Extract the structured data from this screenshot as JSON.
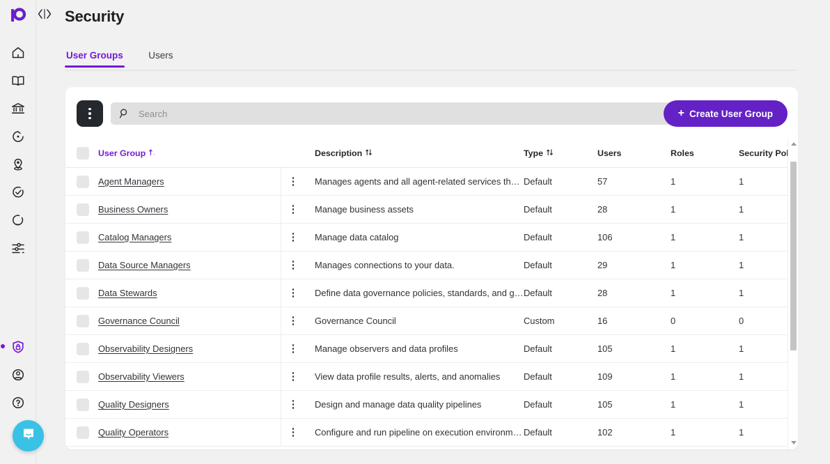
{
  "brand": {
    "logo_name": "prophecy-logo",
    "accent": "#7518d8",
    "button_purple": "#6321c6",
    "chat_color": "#39c1e6"
  },
  "rail": {
    "code_icon": "code-brackets-icon",
    "items": [
      {
        "icon": "home-icon",
        "name": "home"
      },
      {
        "icon": "book-icon",
        "name": "docs"
      },
      {
        "icon": "bank-icon",
        "name": "warehouse"
      },
      {
        "icon": "clock-arrow-icon",
        "name": "jobs"
      },
      {
        "icon": "location-pin-icon",
        "name": "locations"
      },
      {
        "icon": "check-circle-icon",
        "name": "quality"
      },
      {
        "icon": "refresh-circle-icon",
        "name": "observability"
      },
      {
        "icon": "sliders-icon",
        "name": "settings"
      }
    ],
    "bottom_items": [
      {
        "icon": "shield-lock-icon",
        "name": "security",
        "active": true
      },
      {
        "icon": "user-circle-icon",
        "name": "account",
        "active": false
      },
      {
        "icon": "help-circle-icon",
        "name": "help",
        "active": false
      }
    ],
    "chat_icon": "chat-bubble-icon"
  },
  "header": {
    "title": "Security"
  },
  "tabs": [
    {
      "label": "User Groups",
      "active": true
    },
    {
      "label": "Users",
      "active": false
    }
  ],
  "toolbar": {
    "kebab_icon": "more-vertical-icon",
    "search_icon": "search-icon",
    "search_placeholder": "Search",
    "search_value": "",
    "create_label": "Create User Group",
    "create_plus": "+"
  },
  "table": {
    "columns": [
      {
        "key": "name",
        "label": "User Group",
        "sortable": true,
        "sorted": "asc",
        "active": true
      },
      {
        "key": "description",
        "label": "Description",
        "sortable": true,
        "sorted": "none",
        "active": false
      },
      {
        "key": "type",
        "label": "Type",
        "sortable": true,
        "sorted": "none",
        "active": false
      },
      {
        "key": "users",
        "label": "Users",
        "sortable": false,
        "active": false
      },
      {
        "key": "roles",
        "label": "Roles",
        "sortable": false,
        "active": false
      },
      {
        "key": "policies",
        "label": "Security Policies",
        "sortable": false,
        "active": false
      }
    ],
    "rows": [
      {
        "name": "Agent Managers",
        "description": "Manages agents and all agent-related services that ...",
        "type": "Default",
        "users": "57",
        "roles": "1",
        "policies": "1"
      },
      {
        "name": "Business Owners",
        "description": "Manage business assets",
        "type": "Default",
        "users": "28",
        "roles": "1",
        "policies": "1"
      },
      {
        "name": "Catalog Managers",
        "description": "Manage data catalog",
        "type": "Default",
        "users": "106",
        "roles": "1",
        "policies": "1"
      },
      {
        "name": "Data Source Managers",
        "description": "Manages connections to your data.",
        "type": "Default",
        "users": "29",
        "roles": "1",
        "policies": "1"
      },
      {
        "name": "Data Stewards",
        "description": "Define data governance policies, standards, and gui...",
        "type": "Default",
        "users": "28",
        "roles": "1",
        "policies": "1"
      },
      {
        "name": "Governance Council",
        "description": "Governance Council",
        "type": "Custom",
        "users": "16",
        "roles": "0",
        "policies": "0"
      },
      {
        "name": "Observability Designers",
        "description": "Manage observers and data profiles",
        "type": "Default",
        "users": "105",
        "roles": "1",
        "policies": "1"
      },
      {
        "name": "Observability Viewers",
        "description": "View data profile results, alerts, and anomalies",
        "type": "Default",
        "users": "109",
        "roles": "1",
        "policies": "1"
      },
      {
        "name": "Quality Designers",
        "description": "Design and manage data quality pipelines",
        "type": "Default",
        "users": "105",
        "roles": "1",
        "policies": "1"
      },
      {
        "name": "Quality Operators",
        "description": "Configure and run pipeline on execution environment",
        "type": "Default",
        "users": "102",
        "roles": "1",
        "policies": "1"
      }
    ],
    "row_kebab_icon": "more-vertical-icon",
    "row_checkbox_name": "row-checkbox",
    "select_all_name": "select-all-checkbox"
  },
  "scrollbar": {
    "name": "table-vertical-scrollbar"
  }
}
